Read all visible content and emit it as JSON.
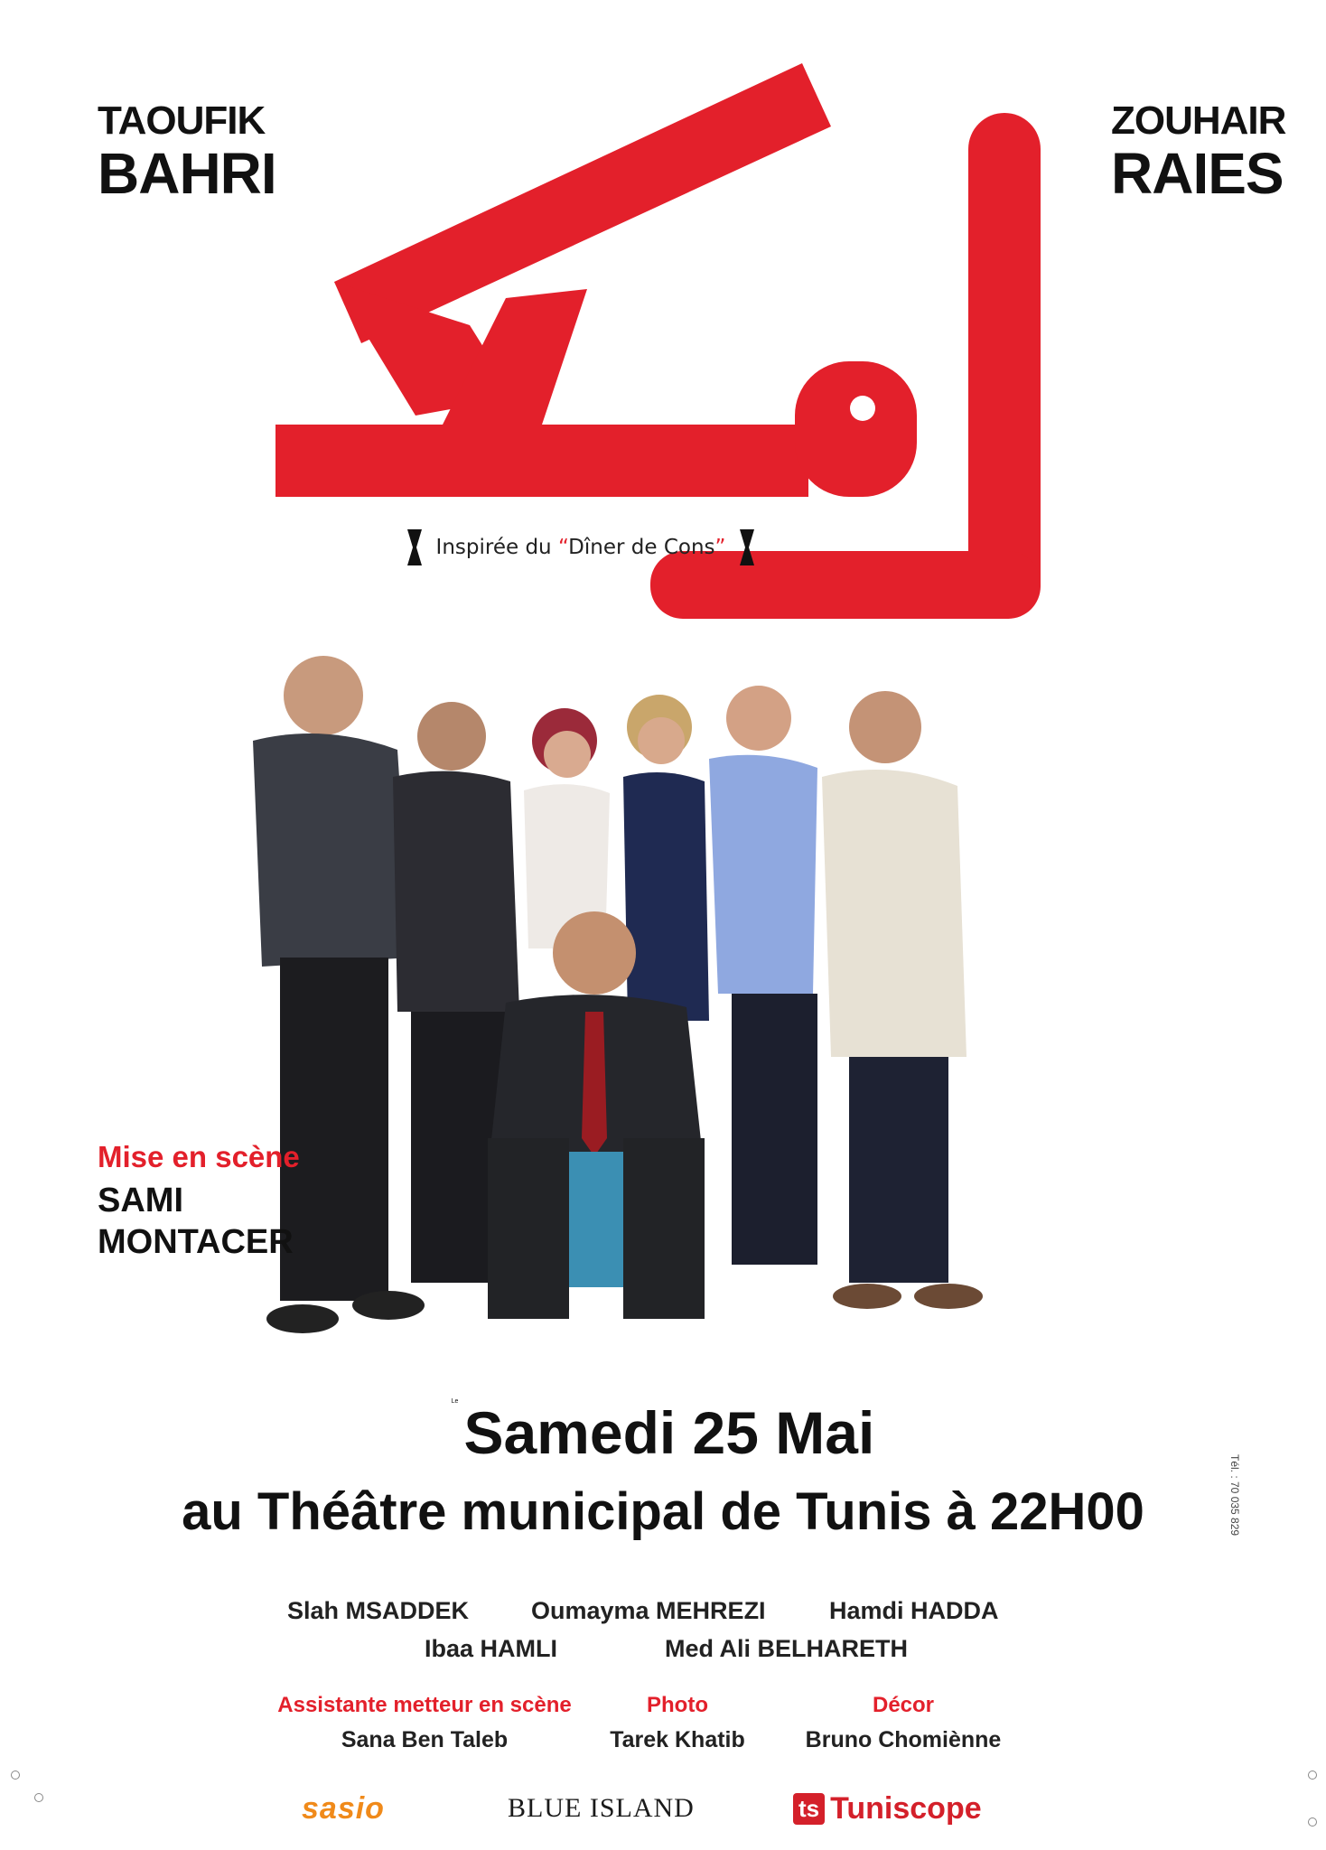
{
  "stars": {
    "left": {
      "first": "TAOUFIK",
      "last": "BAHRI"
    },
    "right": {
      "first": "ZOUHAIR",
      "last": "RAIES"
    }
  },
  "tagline": {
    "prefix": "Inspirée du ",
    "quote_open": "“",
    "title": "Dîner de Cons",
    "quote_close": "”"
  },
  "director": {
    "role": "Mise en scène",
    "first": "SAMI",
    "last": "MONTACER"
  },
  "event": {
    "small_mark": "Le",
    "date": "Samedi 25 Mai",
    "venue": "au Théâtre municipal de Tunis à 22H00"
  },
  "cast": {
    "row1": [
      "Slah MSADDEK",
      "Oumayma MEHREZI",
      "Hamdi HADDA"
    ],
    "row2": [
      "Ibaa HAMLI",
      "Med Ali BELHARETH"
    ]
  },
  "crew": [
    {
      "role": "Assistante metteur en scène",
      "name": "Sana Ben Taleb"
    },
    {
      "role": "Photo",
      "name": "Tarek Khatib"
    },
    {
      "role": "Décor",
      "name": "Bruno Chomiènne"
    }
  ],
  "printer_note": "Tél. : 70 035 829",
  "sponsors": {
    "sasio": "sasio",
    "blue_island": "BLUE ISLAND",
    "tuniscope_badge": "ts",
    "tuniscope": "Tuniscope"
  },
  "colors": {
    "accent_red": "#e3202b",
    "sasio_orange": "#f08a1a",
    "tuniscope_red": "#d4202a",
    "stool_blue": "#3b8fb3"
  }
}
